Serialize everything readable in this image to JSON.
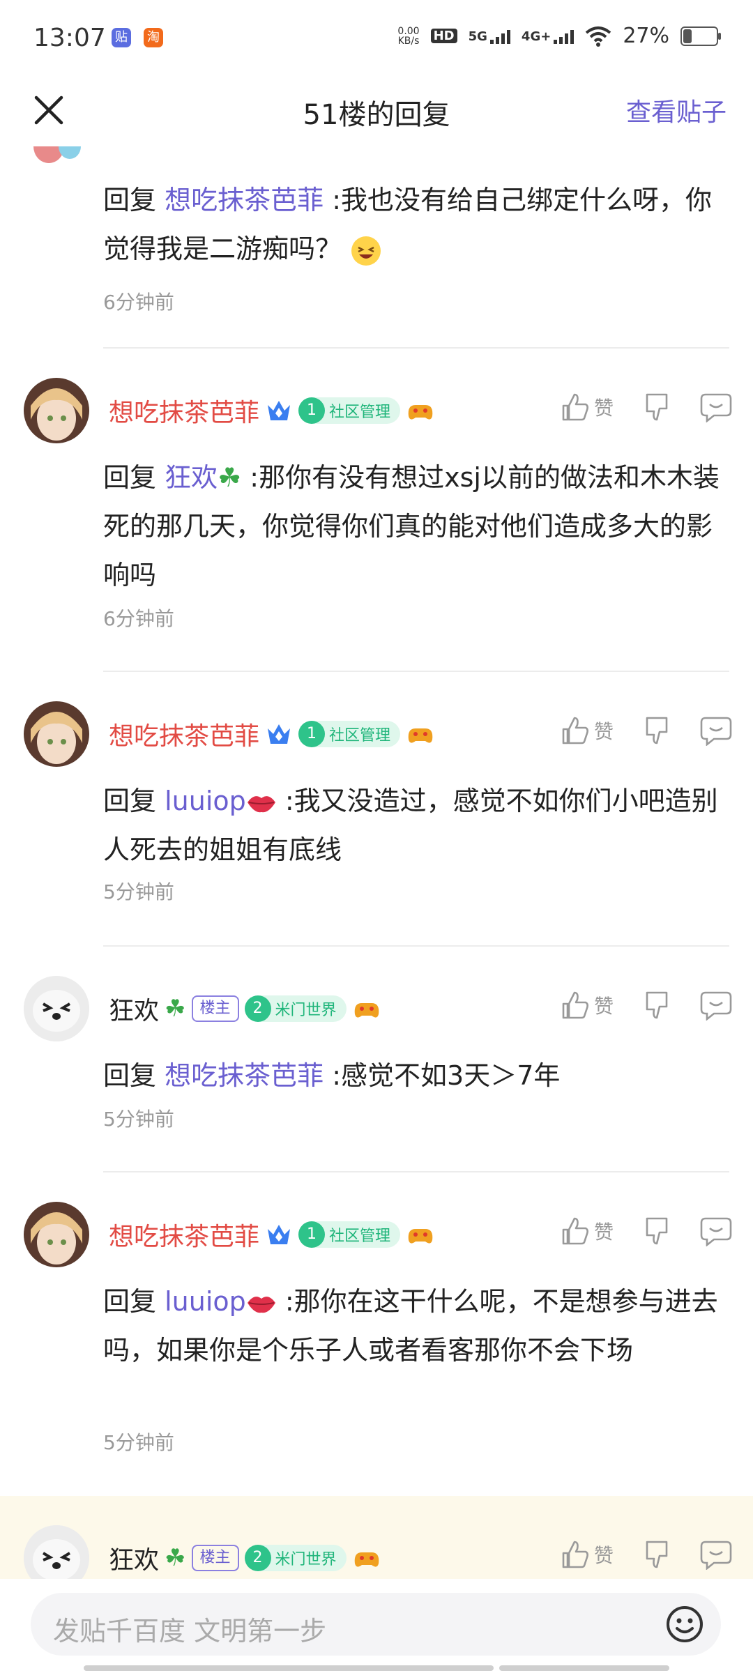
{
  "status_bar": {
    "time": "13:07",
    "app_icons": [
      "贴",
      "淘"
    ],
    "net_speed_value": "0.00",
    "net_speed_unit": "KB/s",
    "hd_label": "HD",
    "signal_5g": "5G",
    "signal_4g": "4G+",
    "battery_text": "27%"
  },
  "header": {
    "title": "51楼的回复",
    "view_post": "查看贴子"
  },
  "top_reply": {
    "prefix": "回复",
    "mention": "想吃抹茶芭菲",
    "text": ":我也没有给自己绑定什么呀，你觉得我是二游痴吗？",
    "time": "6分钟前"
  },
  "replies": [
    {
      "user": "想吃抹茶芭菲",
      "user_color": "#e24b44",
      "badge_level": "1",
      "badge_text": "社区管理",
      "is_owner": false,
      "like_label": "赞",
      "prefix": "回复",
      "mention": "狂欢",
      "text": ":那你有没有想过xsj以前的做法和木木装死的那几天，你觉得你们真的能对他们造成多大的影响吗",
      "time": "6分钟前"
    },
    {
      "user": "想吃抹茶芭菲",
      "user_color": "#e24b44",
      "badge_level": "1",
      "badge_text": "社区管理",
      "is_owner": false,
      "like_label": "赞",
      "prefix": "回复",
      "mention": "luuiop",
      "text": ":我又没造过，感觉不如你们小吧造别人死去的姐姐有底线",
      "time": "5分钟前"
    },
    {
      "user": "狂欢",
      "user_color": "#222222",
      "owner_tag": "楼主",
      "badge_level": "2",
      "badge_text": "米门世界",
      "is_owner": true,
      "like_label": "赞",
      "prefix": "回复",
      "mention": "想吃抹茶芭菲",
      "text": ":感觉不如3天＞7年",
      "time": "5分钟前"
    },
    {
      "user": "想吃抹茶芭菲",
      "user_color": "#e24b44",
      "badge_level": "1",
      "badge_text": "社区管理",
      "is_owner": false,
      "like_label": "赞",
      "prefix": "回复",
      "mention": "luuiop",
      "text": ":那你在这干什么呢，不是想参与进去吗，如果你是个乐子人或者看客那你不会下场",
      "time": "5分钟前"
    },
    {
      "user": "狂欢",
      "user_color": "#222222",
      "owner_tag": "楼主",
      "badge_level": "2",
      "badge_text": "米门世界",
      "is_owner": true,
      "like_label": "赞"
    }
  ],
  "bottom": {
    "input_placeholder": "发贴千百度 文明第一步"
  },
  "icons": [
    "close-icon",
    "like-icon",
    "dislike-icon",
    "comment-icon",
    "smile-icon",
    "clover-icon",
    "lips-icon",
    "crown-icon",
    "game-icon"
  ]
}
